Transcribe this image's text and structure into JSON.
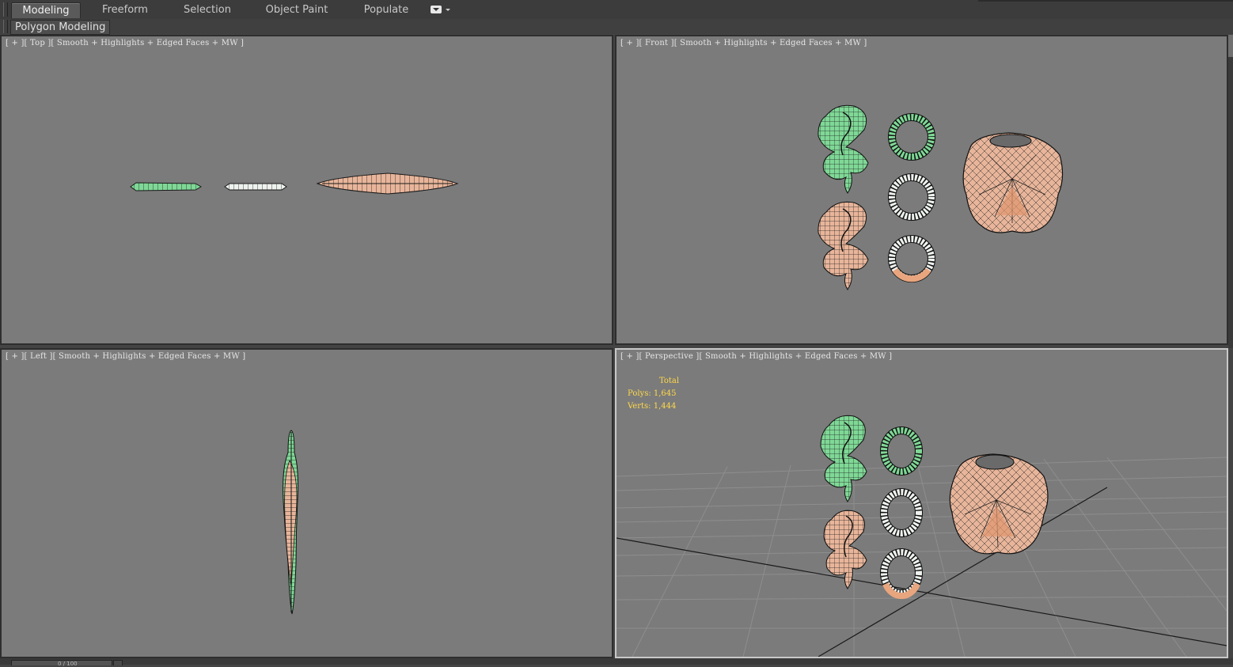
{
  "ribbon": {
    "tabs": [
      {
        "label": "Modeling",
        "active": true
      },
      {
        "label": "Freeform",
        "active": false
      },
      {
        "label": "Selection",
        "active": false
      },
      {
        "label": "Object Paint",
        "active": false
      },
      {
        "label": "Populate",
        "active": false
      }
    ],
    "menu_icon": "dropdown-menu-icon"
  },
  "subbar": {
    "panel_label": "Polygon Modeling"
  },
  "viewports": {
    "top": {
      "label": "[ + ][ Top ][ Smooth + Highlights + Edged Faces + MW ]"
    },
    "front": {
      "label": "[ + ][ Front ][ Smooth + Highlights + Edged Faces + MW ]"
    },
    "left": {
      "label": "[ + ][ Left ][ Smooth + Highlights + Edged Faces + MW ]"
    },
    "perspective": {
      "label": "[ + ][ Perspective ][ Smooth + Highlights + Edged Faces + MW ]",
      "stats": {
        "title": "Total",
        "polys": "Polys: 1,645",
        "verts": "Verts: 1,444"
      }
    }
  },
  "colors": {
    "viewport_bg": "#7b7b7b",
    "green_mesh": "#7fd896",
    "peach_mesh": "#e8b59a",
    "white_mesh": "#eef2ee",
    "stats_text": "#ffd84a"
  },
  "timeline": {
    "counter": "0 / 100"
  }
}
